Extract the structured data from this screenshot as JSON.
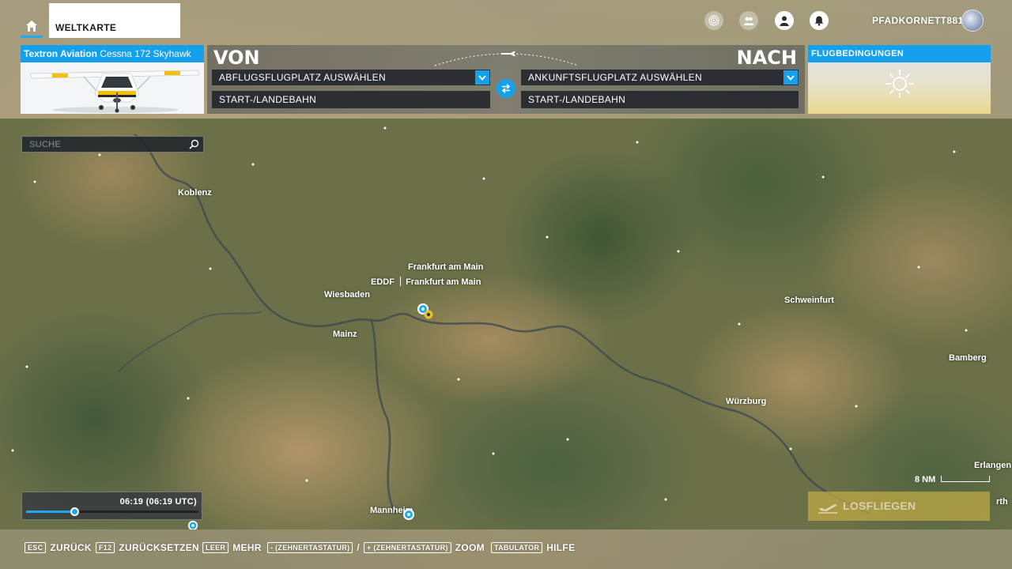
{
  "header": {
    "tab_label": "WELTKARTE",
    "username": "PFADKORNETT881"
  },
  "aircraft": {
    "brand": "Textron Aviation",
    "model": "Cessna 172 Skyhawk"
  },
  "route": {
    "from_label": "VON",
    "to_label": "NACH",
    "departure_placeholder": "ABFLUGSFLUGPLATZ AUSWÄHLEN",
    "arrival_placeholder": "ANKUNFTSFLUGPLATZ AUSWÄHLEN",
    "departure_runway": "START-/LANDEBAHN",
    "arrival_runway": "START-/LANDEBAHN"
  },
  "weather": {
    "title": "FLUGBEDINGUNGEN"
  },
  "map": {
    "search_placeholder": "SUCHE",
    "cities": {
      "koblenz": "Koblenz",
      "frankfurt_city": "Frankfurt am Main",
      "eddf_code": "EDDF",
      "eddf_name": "Frankfurt am Main",
      "wiesbaden": "Wiesbaden",
      "mainz": "Mainz",
      "schweinfurt": "Schweinfurt",
      "bamberg": "Bamberg",
      "wuerzburg": "Würzburg",
      "erlangen": "Erlangen",
      "mannheim": "Mannheim",
      "partial_right": "rth"
    },
    "time": {
      "display": "06:19 (06:19 UTC)",
      "day_fraction": 0.28
    },
    "scale_label": "8 NM",
    "go_button": "LOSFLIEGEN"
  },
  "bottom": {
    "back": {
      "key": "ESC",
      "label": "ZURÜCK"
    },
    "reset": {
      "key": "F12",
      "label": "ZURÜCKSETZEN"
    },
    "more": {
      "key": "LEER",
      "label": "MEHR"
    },
    "zoom": {
      "key_out": "- (ZEHNERTASTATUR)",
      "key_in": "+ (ZEHNERTASTATUR)",
      "separator": "/",
      "label": "ZOOM"
    },
    "help": {
      "key": "TABULATOR",
      "label": "HILFE"
    }
  },
  "colors": {
    "accent": "#14a0ea",
    "go_button": "#c4ac46"
  },
  "icons": {
    "home": "home-icon",
    "activity": "target-icon",
    "friends": "friends-icon",
    "profile": "profile-icon",
    "notifications": "bell-icon",
    "search": "search-icon",
    "swap": "swap-arrows-icon",
    "weather": "sun-icon",
    "go": "plane-takeoff-icon"
  }
}
